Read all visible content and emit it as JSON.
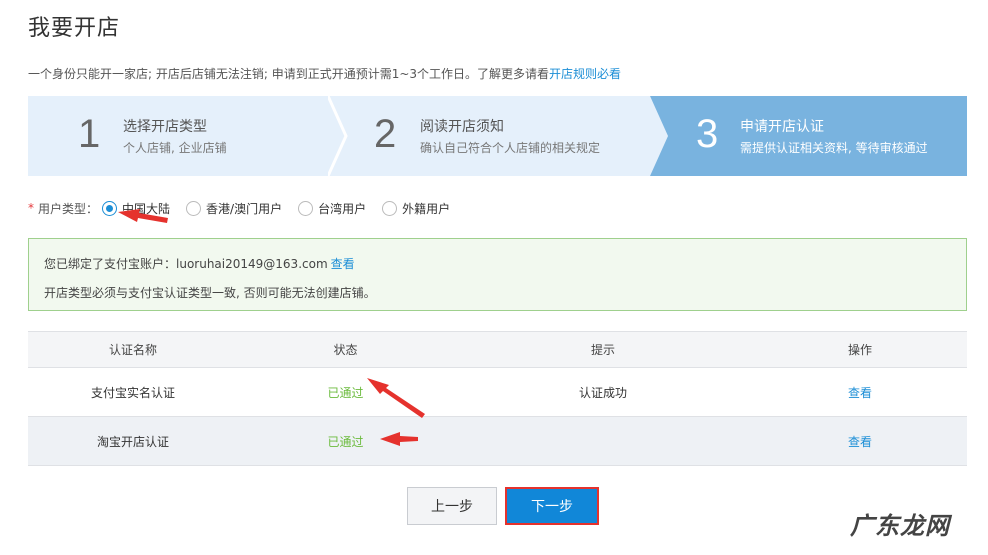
{
  "page": {
    "title": "我要开店",
    "notice_text": "一个身份只能开一家店; 开店后店铺无法注销; 申请到正式开通预计需1~3个工作日。了解更多请看",
    "notice_link": "开店规则必看"
  },
  "steps": [
    {
      "number": "1",
      "title": "选择开店类型",
      "desc": "个人店铺, 企业店铺",
      "active": false
    },
    {
      "number": "2",
      "title": "阅读开店须知",
      "desc": "确认自己符合个人店铺的相关规定",
      "active": false
    },
    {
      "number": "3",
      "title": "申请开店认证",
      "desc": "需提供认证相关资料, 等待审核通过",
      "active": true
    }
  ],
  "user_type": {
    "required_mark": "*",
    "label": "用户类型：",
    "options": [
      "中国大陆",
      "香港/澳门用户",
      "台湾用户",
      "外籍用户"
    ],
    "selected": "中国大陆"
  },
  "alipay": {
    "bound_text": "您已绑定了支付宝账户：luoruhai20149@163.com",
    "view_link": "查看",
    "warning": "开店类型必须与支付宝认证类型一致, 否则可能无法创建店铺。"
  },
  "table": {
    "headers": [
      "认证名称",
      "状态",
      "提示",
      "操作"
    ],
    "rows": [
      {
        "name": "支付宝实名认证",
        "status": "已通过",
        "hint": "认证成功",
        "action": "查看"
      },
      {
        "name": "淘宝开店认证",
        "status": "已通过",
        "hint": "",
        "action": "查看"
      }
    ]
  },
  "buttons": {
    "prev": "上一步",
    "next": "下一步"
  },
  "colors": {
    "accent_blue": "#1c8ed6",
    "step_active": "#79b3df",
    "step_inactive": "#e5f0fb",
    "passed_green": "#6bbb3d",
    "annotation_red": "#e5322d"
  },
  "watermark": "广东龙网"
}
